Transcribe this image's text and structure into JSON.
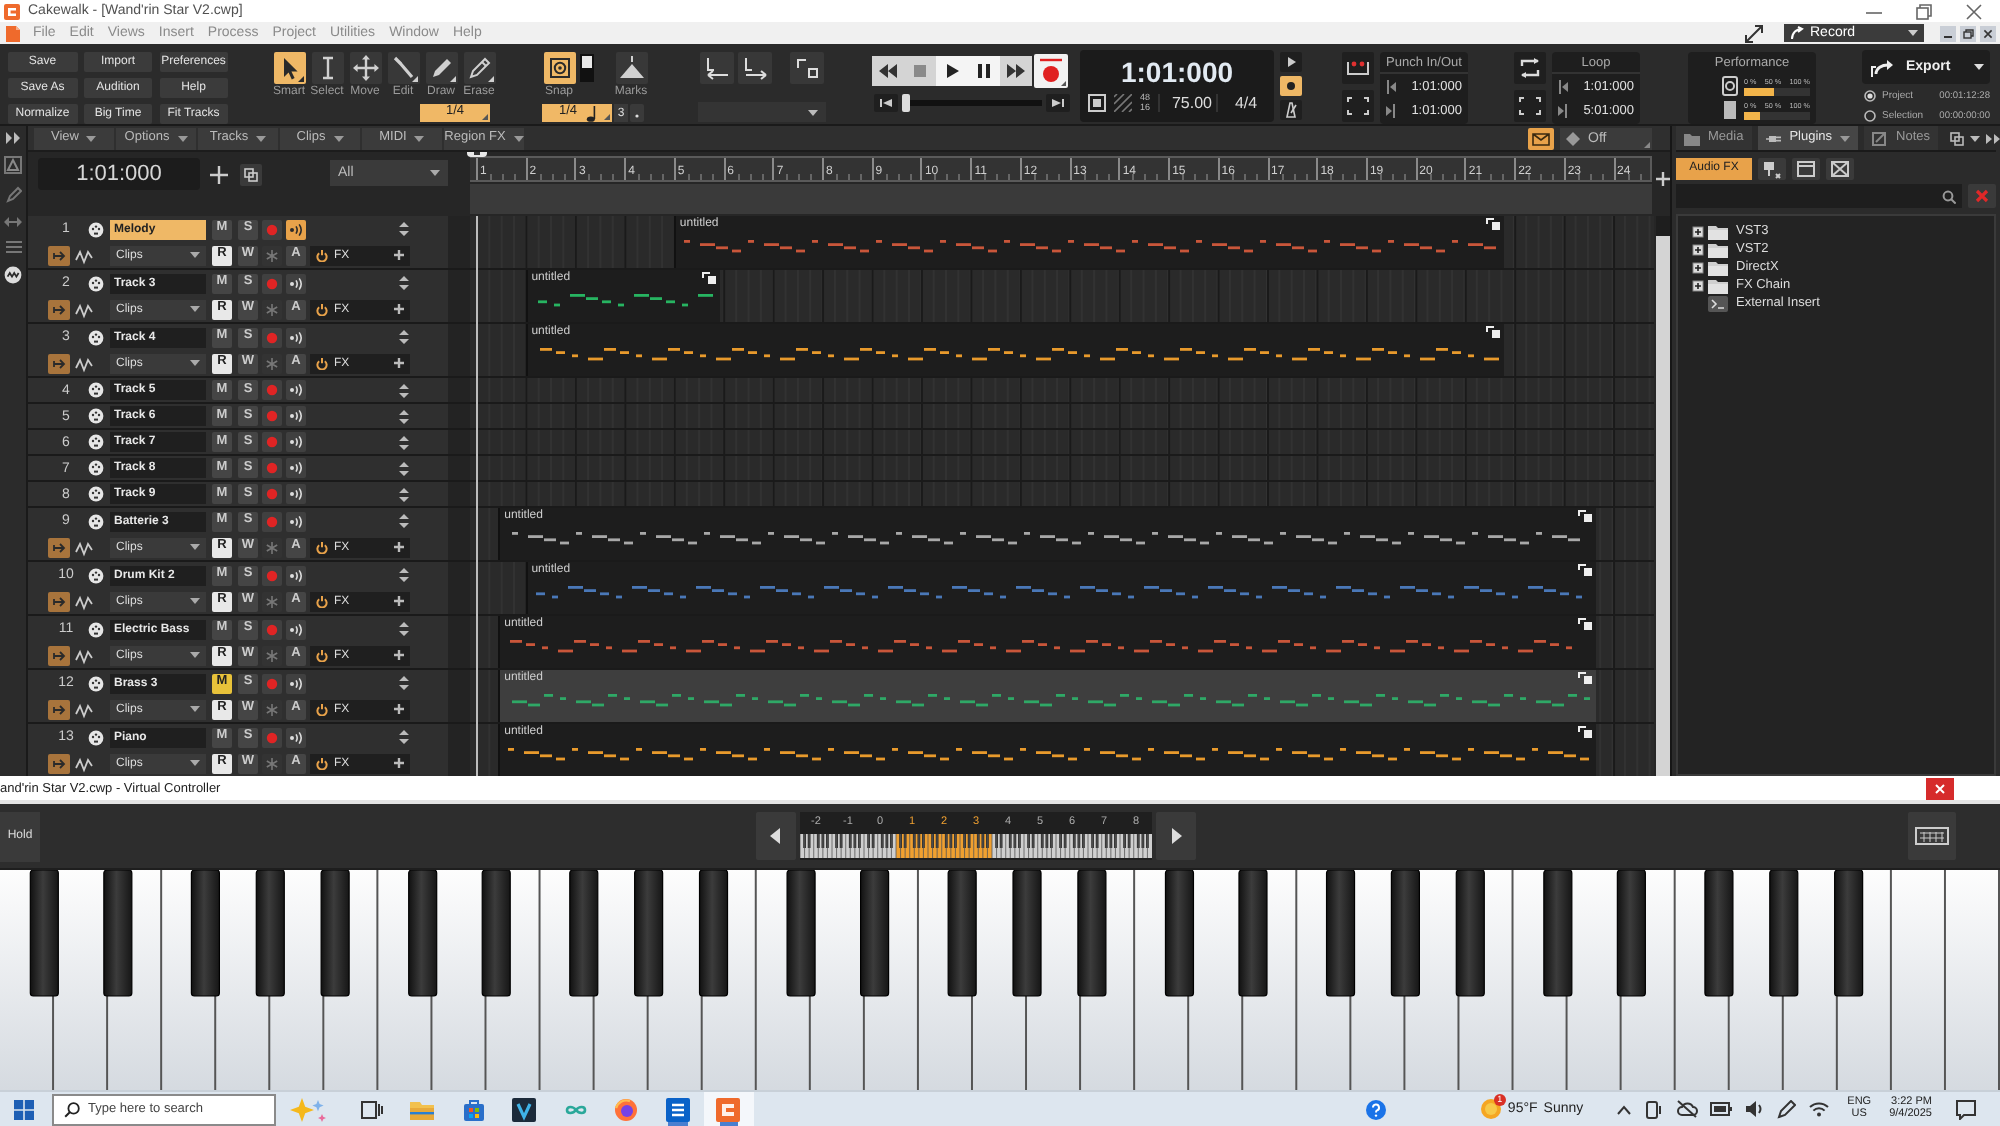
{
  "window": {
    "title": "Cakewalk - [Wand'rin Star V2.cwp]"
  },
  "menu": [
    "File",
    "Edit",
    "Views",
    "Insert",
    "Process",
    "Project",
    "Utilities",
    "Window",
    "Help"
  ],
  "workspace": "Record",
  "control_bar": {
    "buttons": [
      "Save",
      "Import",
      "Preferences",
      "Save As",
      "Audition",
      "Help",
      "Normalize",
      "Big Time",
      "Fit Tracks"
    ],
    "tools": [
      {
        "kind": "smart",
        "label": "Smart",
        "selected": true
      },
      {
        "kind": "select",
        "label": "Select",
        "selected": false
      },
      {
        "kind": "move",
        "label": "Move",
        "selected": false
      },
      {
        "kind": "edit",
        "label": "Edit",
        "selected": false
      },
      {
        "kind": "draw",
        "label": "Draw",
        "selected": false
      },
      {
        "kind": "erase",
        "label": "Erase",
        "selected": false
      }
    ],
    "tool_resolution": "1/4",
    "snap": {
      "label": "Snap",
      "on": true,
      "resolution": "1/4",
      "triplet": "3"
    },
    "marks": {
      "label": "Marks"
    },
    "position": {
      "level": 0
    },
    "now_time": "1:01:000",
    "sample_rate": "48",
    "bit_depth": "16",
    "tempo": "75.00",
    "meter": "4/4",
    "metronome": [
      {
        "kind": "playback",
        "on": false
      },
      {
        "kind": "record",
        "on": true
      },
      {
        "kind": "count_in",
        "on": false
      }
    ],
    "punch": {
      "title": "Punch In/Out",
      "start": "1:01:000",
      "end": "1:01:000"
    },
    "loop": {
      "title": "Loop",
      "start": "1:01:000",
      "end": "5:01:000"
    },
    "performance": {
      "title": "Performance",
      "meters": [
        {
          "kind": "engine",
          "ticks": [
            "0 %",
            "50 %",
            "100 %"
          ],
          "level": 0.45
        },
        {
          "kind": "disk",
          "ticks": [
            "0 %",
            "50 %",
            "100 %"
          ],
          "level": 0.25
        }
      ]
    },
    "export": {
      "label": "Export",
      "ranges": [
        {
          "label": "Project",
          "time": "00:01:12:28",
          "selected": true
        },
        {
          "label": "Selection",
          "time": "00:00:00:00",
          "selected": false
        }
      ]
    }
  },
  "track_view": {
    "menus": [
      "View",
      "Options",
      "Tracks",
      "Clips",
      "MIDI",
      "Region FX"
    ],
    "edit_filter": {
      "on": true,
      "value": "Off"
    },
    "now_time": "1:01:000",
    "filter": "All",
    "ruler": [
      "1",
      "2",
      "3",
      "4",
      "5",
      "6",
      "7",
      "8",
      "9",
      "10",
      "11",
      "12",
      "13",
      "14",
      "15",
      "16",
      "17",
      "18",
      "19",
      "20",
      "21",
      "22",
      "23",
      "24"
    ],
    "tracks": [
      {
        "number": "1",
        "name": "Melody",
        "selected": true,
        "expanded": true,
        "mute": {
          "label": "M",
          "on": false
        },
        "solo": {
          "label": "S",
          "on": false
        },
        "armed": false,
        "input_echo": true,
        "read": {
          "label": "R",
          "on": true
        },
        "write": {
          "label": "W",
          "on": false
        },
        "frozen": false,
        "archive": {
          "label": "A",
          "on": false
        },
        "clips_mode": "Clips",
        "fx": "FX",
        "clip": {
          "title": "untitled",
          "color": "#c9563a"
        }
      },
      {
        "number": "2",
        "name": "Track 3",
        "selected": false,
        "expanded": true,
        "mute": {
          "label": "M",
          "on": false
        },
        "solo": {
          "label": "S",
          "on": false
        },
        "armed": false,
        "input_echo": false,
        "read": {
          "label": "R",
          "on": true
        },
        "write": {
          "label": "W",
          "on": false
        },
        "frozen": false,
        "archive": {
          "label": "A",
          "on": false
        },
        "clips_mode": "Clips",
        "fx": "FX",
        "clip": {
          "title": "untitled",
          "color": "#27b461"
        }
      },
      {
        "number": "3",
        "name": "Track 4",
        "selected": false,
        "expanded": true,
        "mute": {
          "label": "M",
          "on": false
        },
        "solo": {
          "label": "S",
          "on": false
        },
        "armed": false,
        "input_echo": false,
        "read": {
          "label": "R",
          "on": true
        },
        "write": {
          "label": "W",
          "on": false
        },
        "frozen": false,
        "archive": {
          "label": "A",
          "on": false
        },
        "clips_mode": "Clips",
        "fx": "FX",
        "clip": {
          "title": "untitled",
          "color": "#e89a2c"
        }
      },
      {
        "number": "4",
        "name": "Track 5",
        "selected": false,
        "expanded": false,
        "mute": {
          "label": "M",
          "on": false
        },
        "solo": {
          "label": "S",
          "on": false
        },
        "armed": false,
        "input_echo": false
      },
      {
        "number": "5",
        "name": "Track 6",
        "selected": false,
        "expanded": false,
        "mute": {
          "label": "M",
          "on": false
        },
        "solo": {
          "label": "S",
          "on": false
        },
        "armed": false,
        "input_echo": false
      },
      {
        "number": "6",
        "name": "Track 7",
        "selected": false,
        "expanded": false,
        "mute": {
          "label": "M",
          "on": false
        },
        "solo": {
          "label": "S",
          "on": false
        },
        "armed": false,
        "input_echo": false
      },
      {
        "number": "7",
        "name": "Track 8",
        "selected": false,
        "expanded": false,
        "mute": {
          "label": "M",
          "on": false
        },
        "solo": {
          "label": "S",
          "on": false
        },
        "armed": false,
        "input_echo": false
      },
      {
        "number": "8",
        "name": "Track 9",
        "selected": false,
        "expanded": false,
        "mute": {
          "label": "M",
          "on": false
        },
        "solo": {
          "label": "S",
          "on": false
        },
        "armed": false,
        "input_echo": false
      },
      {
        "number": "9",
        "name": "Batterie 3",
        "selected": false,
        "expanded": true,
        "mute": {
          "label": "M",
          "on": false
        },
        "solo": {
          "label": "S",
          "on": false
        },
        "armed": false,
        "input_echo": false,
        "read": {
          "label": "R",
          "on": true
        },
        "write": {
          "label": "W",
          "on": false
        },
        "frozen": false,
        "archive": {
          "label": "A",
          "on": false
        },
        "clips_mode": "Clips",
        "fx": "FX",
        "clip": {
          "title": "untitled",
          "color": "#a8a8a8"
        }
      },
      {
        "number": "10",
        "name": "Drum Kit 2",
        "selected": false,
        "expanded": true,
        "mute": {
          "label": "M",
          "on": false
        },
        "solo": {
          "label": "S",
          "on": false
        },
        "armed": false,
        "input_echo": false,
        "read": {
          "label": "R",
          "on": true
        },
        "write": {
          "label": "W",
          "on": false
        },
        "frozen": false,
        "archive": {
          "label": "A",
          "on": false
        },
        "clips_mode": "Clips",
        "fx": "FX",
        "clip": {
          "title": "untitled",
          "color": "#4a78b8"
        }
      },
      {
        "number": "11",
        "name": "Electric Bass",
        "selected": false,
        "expanded": true,
        "mute": {
          "label": "M",
          "on": false
        },
        "solo": {
          "label": "S",
          "on": false
        },
        "armed": false,
        "input_echo": false,
        "read": {
          "label": "R",
          "on": true
        },
        "write": {
          "label": "W",
          "on": false
        },
        "frozen": false,
        "archive": {
          "label": "A",
          "on": false
        },
        "clips_mode": "Clips",
        "fx": "FX",
        "clip": {
          "title": "untitled",
          "color": "#c9563a"
        }
      },
      {
        "number": "12",
        "name": "Brass 3",
        "selected": false,
        "expanded": true,
        "mute": {
          "label": "M",
          "on": true
        },
        "solo": {
          "label": "S",
          "on": false
        },
        "armed": false,
        "input_echo": false,
        "read": {
          "label": "R",
          "on": true
        },
        "write": {
          "label": "W",
          "on": false
        },
        "frozen": false,
        "archive": {
          "label": "A",
          "on": false
        },
        "clips_mode": "Clips",
        "fx": "FX",
        "clip": {
          "title": "untitled",
          "color": "#2fa866"
        }
      },
      {
        "number": "13",
        "name": "Piano",
        "selected": false,
        "expanded": true,
        "mute": {
          "label": "M",
          "on": false
        },
        "solo": {
          "label": "S",
          "on": false
        },
        "armed": false,
        "input_echo": false,
        "read": {
          "label": "R",
          "on": true
        },
        "write": {
          "label": "W",
          "on": false
        },
        "frozen": false,
        "archive": {
          "label": "A",
          "on": false
        },
        "clips_mode": "Clips",
        "fx": "FX",
        "clip": {
          "title": "untitled",
          "color": "#e89a2c"
        }
      }
    ]
  },
  "browser": {
    "tabs": [
      {
        "kind": "media",
        "label": "Media",
        "selected": false
      },
      {
        "kind": "plugins",
        "label": "Plugins",
        "selected": true
      },
      {
        "kind": "notes",
        "label": "Notes",
        "selected": false
      }
    ],
    "plugin_types": [
      {
        "kind": "audio",
        "label": "Audio FX",
        "selected": true
      },
      {
        "kind": "instrument",
        "selected": false
      },
      {
        "kind": "midi",
        "selected": false
      },
      {
        "kind": "chain",
        "selected": false
      }
    ],
    "tree": [
      {
        "kind": "folder",
        "label": "VST3",
        "expanded": false
      },
      {
        "kind": "folder",
        "label": "VST2",
        "expanded": false
      },
      {
        "kind": "folder",
        "label": "DirectX",
        "expanded": false
      },
      {
        "kind": "folder",
        "label": "FX Chain",
        "expanded": false
      },
      {
        "kind": "plugin",
        "label": "External Insert"
      }
    ]
  },
  "virtual_controller": {
    "title": "and'rin Star V2.cwp - Virtual Controller",
    "hold": "Hold",
    "octaves": [
      {
        "label": "-2",
        "selected": false
      },
      {
        "label": "-1",
        "selected": false
      },
      {
        "label": "0",
        "selected": false
      },
      {
        "label": "1",
        "selected": true
      },
      {
        "label": "2",
        "selected": true
      },
      {
        "label": "3",
        "selected": true
      },
      {
        "label": "4",
        "selected": false
      },
      {
        "label": "5",
        "selected": false
      },
      {
        "label": "6",
        "selected": false
      },
      {
        "label": "7",
        "selected": false
      },
      {
        "label": "8",
        "selected": false
      }
    ]
  },
  "taskbar": {
    "search": {
      "placeholder": "Type here to search"
    },
    "apps": [
      {
        "kind": "task_view",
        "open": false,
        "selected": false
      },
      {
        "kind": "explorer",
        "open": false,
        "selected": false
      },
      {
        "kind": "store",
        "open": false,
        "selected": false
      },
      {
        "kind": "v_app",
        "open": false,
        "selected": false
      },
      {
        "kind": "infinity",
        "open": false,
        "selected": false
      },
      {
        "kind": "firefox",
        "open": false,
        "selected": false
      },
      {
        "kind": "e_app",
        "open": true,
        "selected": false
      },
      {
        "kind": "cakewalk",
        "open": true,
        "selected": true
      }
    ],
    "weather": {
      "badge": "1",
      "temperature": "95°F",
      "condition": "Sunny"
    },
    "language": "ENG",
    "region": "US",
    "time": "3:22 PM",
    "date": "9/4/2025"
  }
}
